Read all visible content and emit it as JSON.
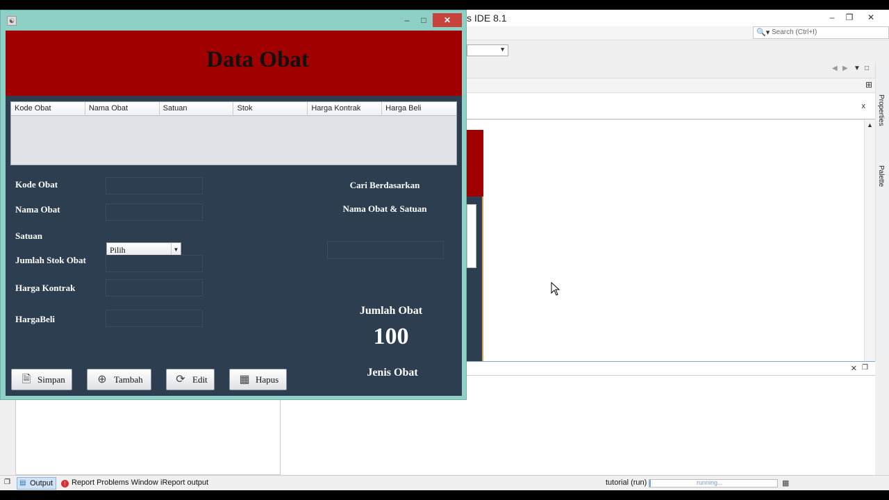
{
  "ide": {
    "title_fragment": "s IDE 8.1",
    "search_placeholder": "Search (Ctrl+I)",
    "file_tab_close": "x",
    "side_tabs": [
      "Properties",
      "Palette"
    ],
    "statusbar": {
      "output_label": "Output",
      "report_problems_label": "Report Problems Window",
      "ireport_label": "iReport output",
      "run_label": "tutorial (run)",
      "progress_text": "running..."
    }
  },
  "app": {
    "header_title": "Data Obat",
    "table": {
      "columns": [
        "Kode Obat",
        "Nama Obat",
        "Satuan",
        "Stok",
        "Harga Kontrak",
        "Harga Beli"
      ],
      "rows": []
    },
    "form": {
      "kode_label": "Kode Obat",
      "nama_label": "Nama Obat",
      "satuan_label": "Satuan",
      "satuan_value": "Pilih",
      "stok_label": "Jumlah Stok Obat",
      "harga_kontrak_label": "Harga Kontrak",
      "harga_beli_label": "HargaBeli"
    },
    "search": {
      "title": "Cari Berdasarkan",
      "subtitle": "Nama Obat & Satuan",
      "value": ""
    },
    "summary": {
      "jumlah_label": "Jumlah Obat",
      "jumlah_value": "100",
      "jenis_label": "Jenis Obat"
    },
    "buttons": {
      "simpan": "Simpan",
      "tambah": "Tambah",
      "edit": "Edit",
      "hapus": "Hapus"
    }
  },
  "colors": {
    "header_red": "#a00000",
    "panel_dark": "#2c3e50",
    "window_frame": "#8ecfc6",
    "close_button": "#c7423a"
  }
}
